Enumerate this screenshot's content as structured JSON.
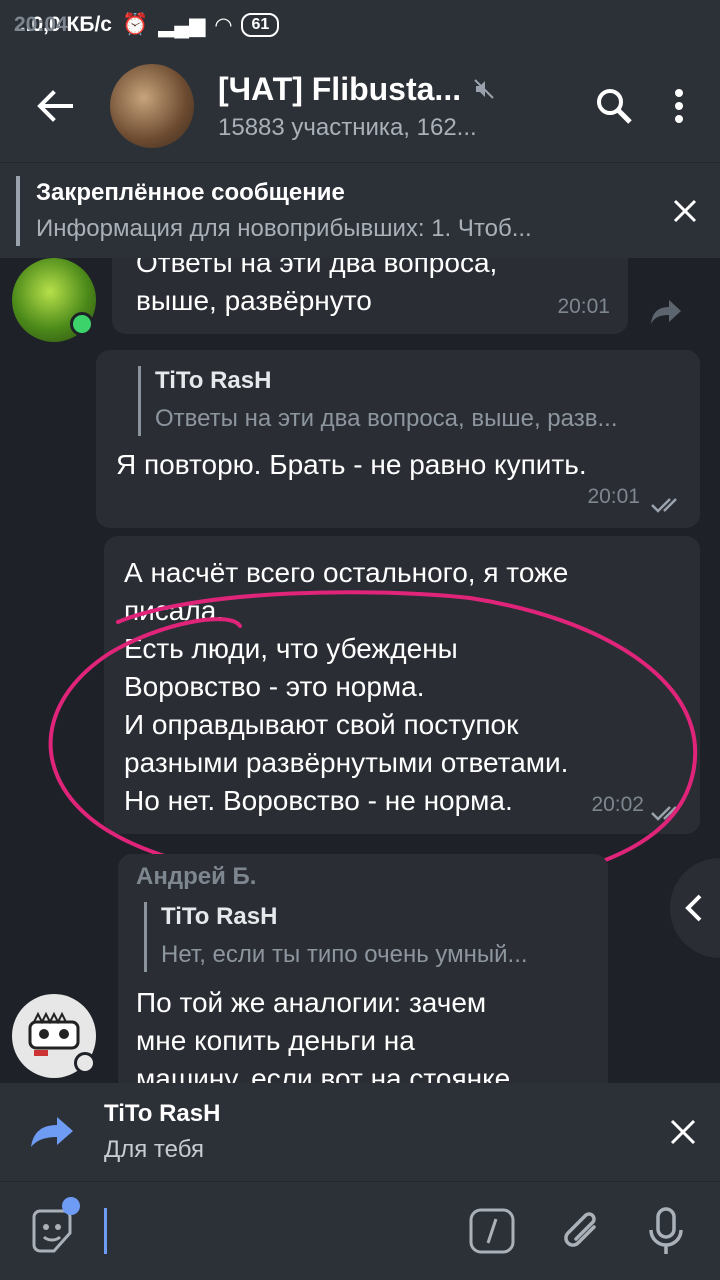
{
  "status": {
    "time": "20:04",
    "net": "...0,0 КБ/с",
    "battery": "61"
  },
  "header": {
    "title": "[ЧАТ] Flibusta...",
    "subtitle": "15883 участника, 162..."
  },
  "pinned": {
    "title": "Закреплённое сообщение",
    "text": "Информация для новоприбывших:  1. Чтоб..."
  },
  "messages": [
    {
      "lines": [
        "Ответы на эти два вопроса,",
        "выше, развёрнуто"
      ],
      "time": "20:01"
    },
    {
      "reply_name": "TiTo RasH",
      "reply_text": "Ответы на эти два вопроса, выше, разв...",
      "text": "Я повторю. Брать - не равно купить.",
      "time": "20:01"
    },
    {
      "lines": [
        "А насчёт всего остального, я тоже",
        "писала.",
        "Есть люди, что убеждены",
        "Воровство - это норма.",
        "И оправдывают свой поступок",
        "разными развёрнутыми ответами.",
        "Но нет. Воровство - не норма."
      ],
      "time": "20:02"
    },
    {
      "sender": "Андрей Б.",
      "reply_name": "TiTo RasH",
      "reply_text": "Нет, если ты типо очень умный...",
      "lines": [
        "По той же аналогии: зачем",
        "мне копить деньги на",
        "машину, если вот на стоянке"
      ]
    }
  ],
  "reply_bar": {
    "name": "TiTo RasH",
    "text": "Для тебя"
  },
  "colors": {
    "accent": "#6e9cf5",
    "annotation": "#e0247a",
    "online": "#3cd36b"
  }
}
